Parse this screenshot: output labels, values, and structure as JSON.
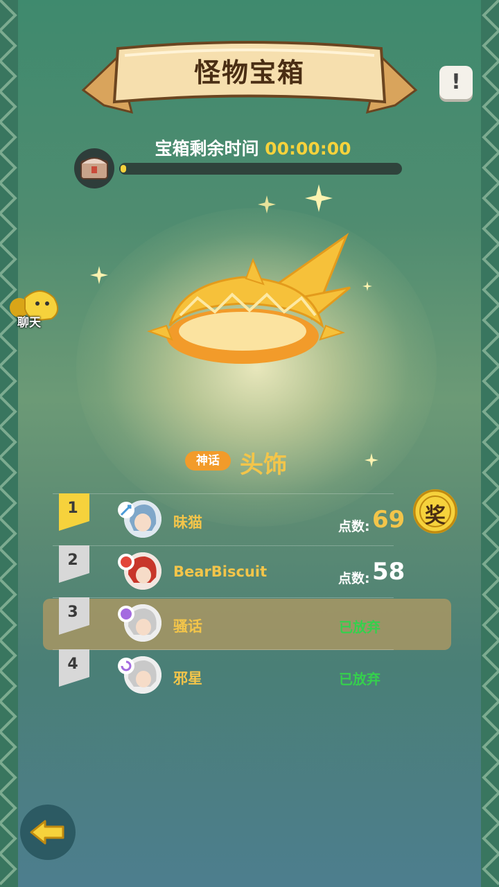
{
  "header": {
    "title": "怪物宝箱",
    "help_label": "!"
  },
  "timer": {
    "label": "宝箱剩余时间",
    "time": "00:00:00",
    "progress": 0.02
  },
  "chat": {
    "label": "聊天"
  },
  "item": {
    "rarity": "神话",
    "name": "头饰"
  },
  "leaderboard": [
    {
      "rank": "1",
      "name": "昧猫",
      "score_label": "点数:",
      "score": "69",
      "status": "",
      "highlight": false,
      "rank_color": "#f6d23c"
    },
    {
      "rank": "2",
      "name": "BearBiscuit",
      "score_label": "点数:",
      "score": "58",
      "status": "",
      "highlight": false,
      "rank_color": "#e8e8e8"
    },
    {
      "rank": "3",
      "name": "骚话",
      "score_label": "",
      "score": "",
      "status": "已放弃",
      "highlight": true,
      "rank_color": "#e8e8e8"
    },
    {
      "rank": "4",
      "name": "邪星",
      "score_label": "",
      "score": "",
      "status": "已放弃",
      "highlight": false,
      "rank_color": "#e8e8e8"
    }
  ],
  "prize": {
    "label": "奖"
  },
  "colors": {
    "gold": "#f3c54a",
    "green": "#35d04d",
    "accent": "#f29b2a"
  }
}
